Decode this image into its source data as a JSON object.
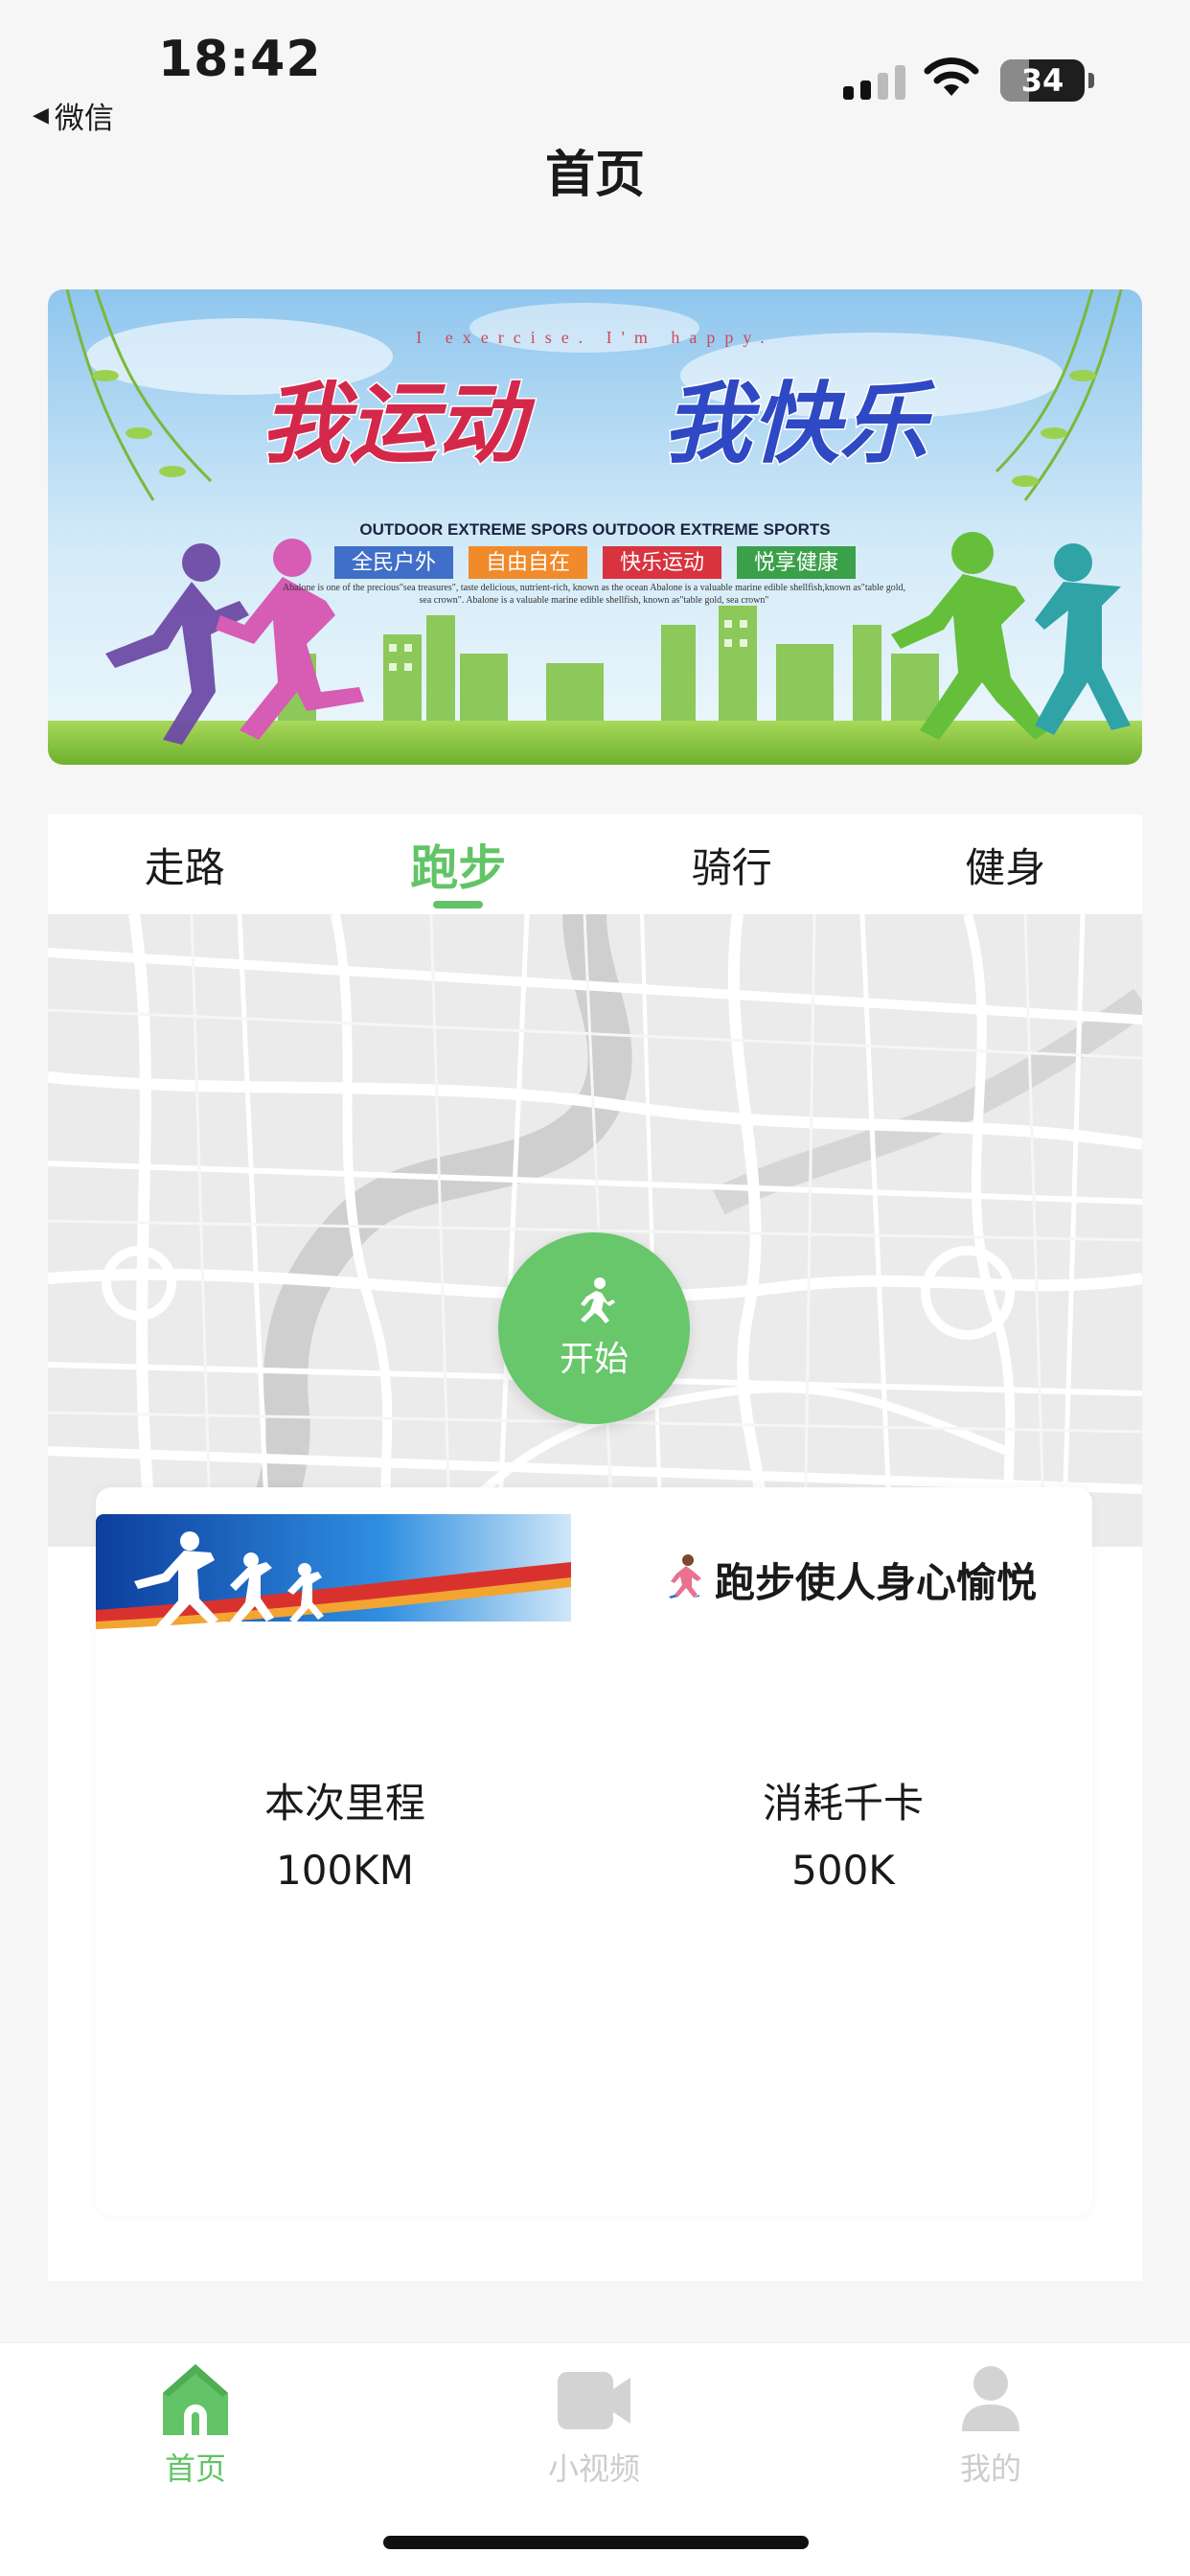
{
  "status_bar": {
    "time": "18:42",
    "back_app": "微信",
    "battery": "34",
    "battery_level": 0.34
  },
  "header": {
    "title": "首页"
  },
  "banner": {
    "tagline": "I exercise. I'm happy.",
    "headline_left": "我运动",
    "headline_right": "我快乐",
    "subline": "OUTDOOR EXTREME SPORS OUTDOOR EXTREME SPORTS",
    "tags": [
      "全民户外",
      "自由自在",
      "快乐运动",
      "悦享健康"
    ],
    "tag_colors": [
      "#3f6fc9",
      "#f08a2a",
      "#d8333f",
      "#3aa04a"
    ],
    "blurb": "Abalone is one of the precious\"sea treasures\", taste delicious, nutrient-rich, known as the ocean Abalone is a valuable marine edible shellfish,known as\"table gold, sea crown\". Abalone is a valuable marine edible shellfish, known as\"table gold, sea crown\""
  },
  "tabs": [
    {
      "label": "走路",
      "active": false
    },
    {
      "label": "跑步",
      "active": true
    },
    {
      "label": "骑行",
      "active": false
    },
    {
      "label": "健身",
      "active": false
    }
  ],
  "start_button": {
    "label": "开始",
    "icon": "running-icon"
  },
  "card": {
    "title": "跑步使人身心愉悦",
    "title_icon": "runner-emoji-icon",
    "stats": [
      {
        "label": "本次里程",
        "value": "100KM"
      },
      {
        "label": "消耗千卡",
        "value": "500K"
      }
    ]
  },
  "bottom_nav": [
    {
      "label": "首页",
      "icon": "home-icon",
      "active": true
    },
    {
      "label": "小视频",
      "icon": "video-camera-icon",
      "active": false
    },
    {
      "label": "我的",
      "icon": "user-icon",
      "active": false
    }
  ],
  "colors": {
    "accent": "#62c466",
    "inactive": "#cccccc"
  }
}
